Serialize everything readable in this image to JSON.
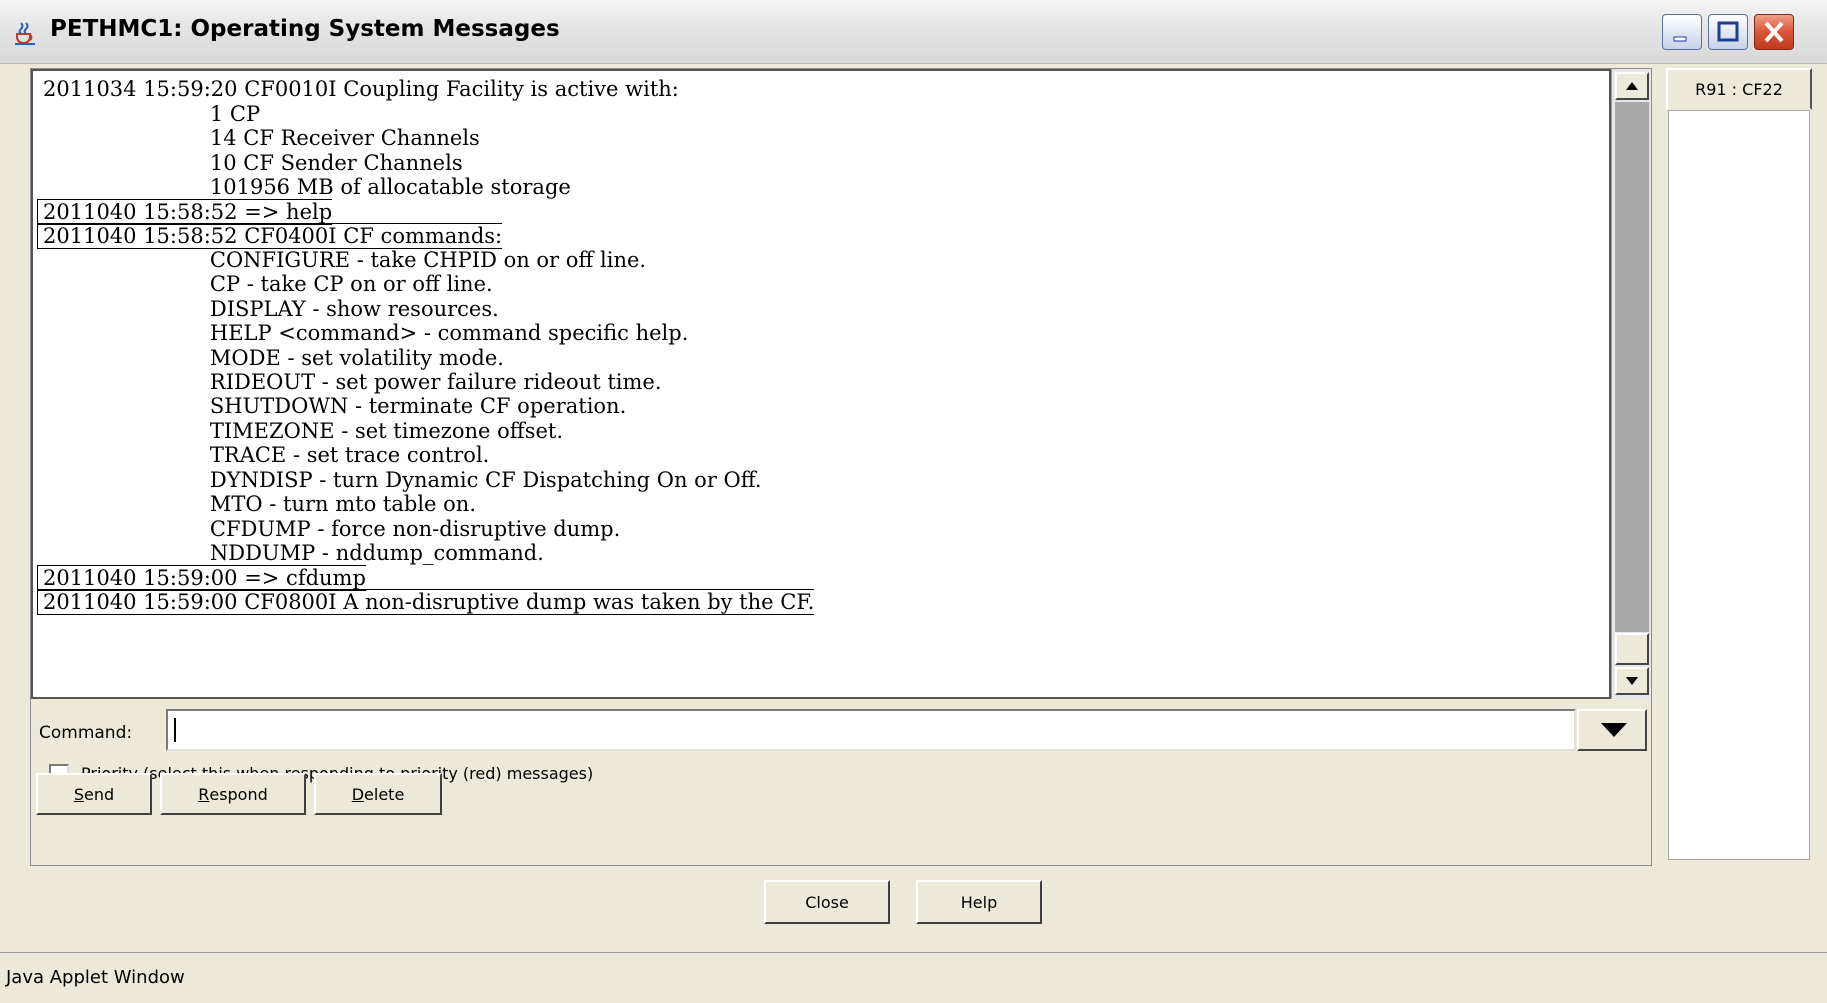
{
  "window": {
    "title": "PETHMC1: Operating System Messages"
  },
  "log": {
    "lines": [
      "2011034 15:59:20 CF0010I Coupling Facility is active with:",
      "                         1 CP",
      "                         14 CF Receiver Channels",
      "                         10 CF Sender Channels",
      "                         101956 MB of allocatable storage",
      "2011040 15:58:52 => help",
      "2011040 15:58:52 CF0400I CF commands:",
      "                         CONFIGURE - take CHPID on or off line.",
      "                         CP - take CP on or off line.",
      "                         DISPLAY - show resources.",
      "                         HELP <command> - command specific help.",
      "                         MODE - set volatility mode.",
      "                         RIDEOUT - set power failure rideout time.",
      "                         SHUTDOWN - terminate CF operation.",
      "                         TIMEZONE - set timezone offset.",
      "                         TRACE - set trace control.",
      "                         DYNDISP - turn Dynamic CF Dispatching On or Off.",
      "                         MTO - turn mto table on.",
      "                         CFDUMP - force non-disruptive dump.",
      "                         NDDUMP - nddump_command.",
      "2011040 15:59:00 => cfdump",
      "2011040 15:59:00 CF0800I A non-disruptive dump was taken by the CF."
    ]
  },
  "command": {
    "label": "Command:",
    "value": ""
  },
  "priority": {
    "mnemonic": "P",
    "label_rest": "riority (select this when responding to priority (red) messages)",
    "checked": false
  },
  "buttons": {
    "send_mnemonic": "S",
    "send_rest": "end",
    "respond_mnemonic": "R",
    "respond_rest": "espond",
    "delete_mnemonic": "D",
    "delete_rest": "elete",
    "close": "Close",
    "help": "Help"
  },
  "side_tab": {
    "label": "R91 : CF22"
  },
  "status": {
    "text": "Java Applet Window"
  },
  "colors": {
    "window_bg": "#ece9d8",
    "scroll_track": "#a9a9a9",
    "close_button": "#d9553a"
  }
}
